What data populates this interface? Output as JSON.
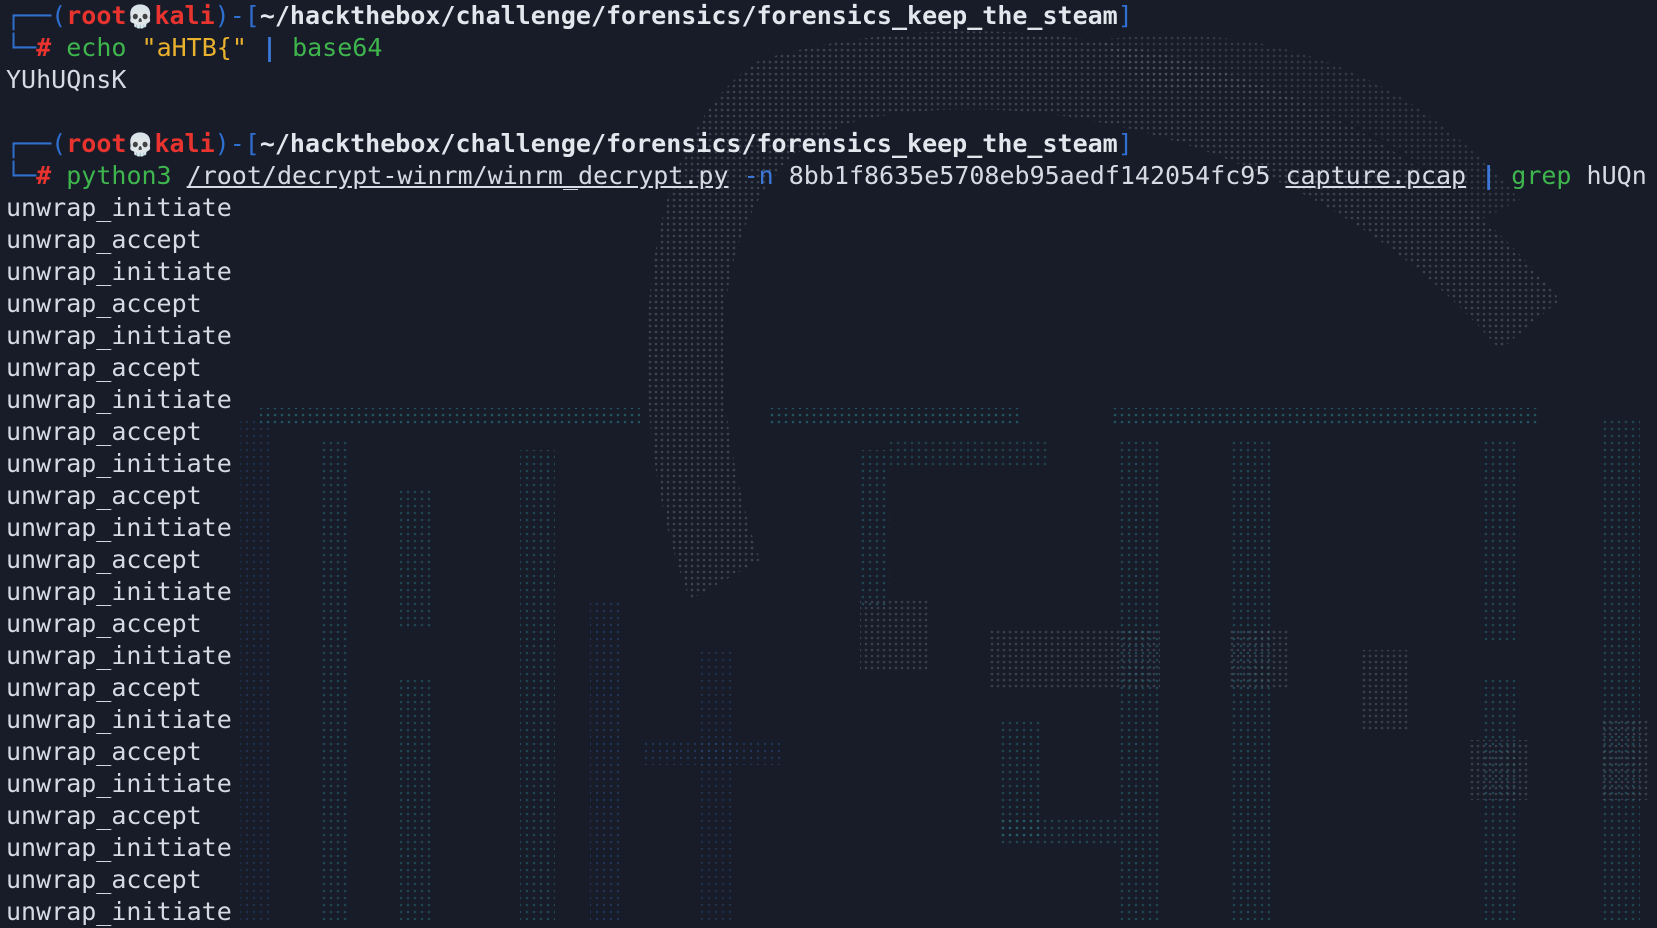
{
  "prompt": {
    "user": "root",
    "skull": "💀",
    "host": "kali",
    "cwd": "~/hackthebox/challenge/forensics/forensics_keep_the_steam",
    "hash": "#",
    "top_left": "┌──(",
    "sep_close": ")-[",
    "cwd_close": "]",
    "bottom_left": "└─"
  },
  "command1": {
    "cmd": "echo",
    "arg": "\"aHTB{\"",
    "pipe": "|",
    "pipe_cmd": "base64"
  },
  "output1": "YUhUQnsK",
  "command2": {
    "cmd": "python3",
    "script": "/root/decrypt-winrm/winrm_decrypt.py",
    "opt": "-n",
    "hash": "8bb1f8635e5708eb95aedf142054fc95",
    "file": "capture.pcap",
    "pipe": "|",
    "grep": "grep",
    "pattern": "hUQn"
  },
  "output_lines": [
    "unwrap_initiate",
    "unwrap_accept",
    "unwrap_initiate",
    "unwrap_accept",
    "unwrap_initiate",
    "unwrap_accept",
    "unwrap_initiate",
    "unwrap_accept",
    "unwrap_initiate",
    "unwrap_accept",
    "unwrap_initiate",
    "unwrap_accept",
    "unwrap_initiate",
    "unwrap_accept",
    "unwrap_initiate",
    "unwrap_accept",
    "unwrap_initiate",
    "unwrap_accept",
    "unwrap_initiate",
    "unwrap_accept",
    "unwrap_initiate",
    "unwrap_accept",
    "unwrap_initiate"
  ],
  "colors": {
    "background": "#171c28",
    "prompt_blue": "#2f6fd0",
    "user_red": "#e8332e",
    "command_green": "#3fb54d",
    "string_yellow": "#e9b12c",
    "text": "#d6dae3"
  },
  "icons": {
    "skull": "skull-icon"
  }
}
